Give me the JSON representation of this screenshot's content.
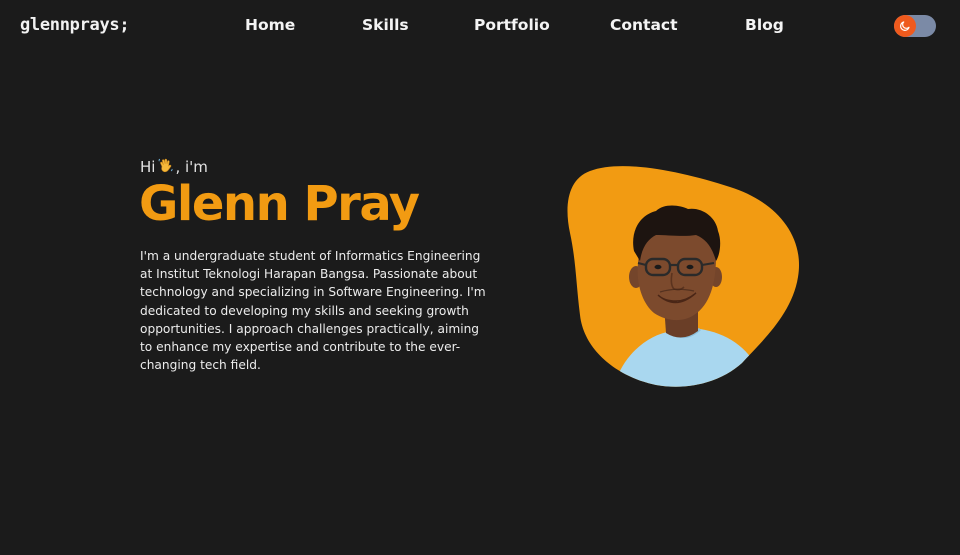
{
  "header": {
    "logo": "glennprays;",
    "nav": {
      "home": "Home",
      "skills": "Skills",
      "portfolio": "Portfolio",
      "contact": "Contact",
      "blog": "Blog"
    },
    "theme_toggle": {
      "icon": "moon-icon",
      "state": "dark"
    }
  },
  "hero": {
    "greeting_before": "Hi",
    "greeting_icon": "waving-hand-icon",
    "greeting_after": ", i'm",
    "name": "Glenn Pray",
    "bio": "I'm a undergraduate student of Informatics Engineering at Institut Teknologi Harapan Bangsa. Passionate about technology and specializing in Software Engineering. I'm dedicated to developing my skills and seeking growth opportunities. I approach challenges practically, aiming to enhance my expertise and contribute to the ever-changing tech field.",
    "photo": "profile-photo"
  },
  "colors": {
    "background": "#1b1b1b",
    "accent": "#f29b12",
    "toggle_knob": "#ef5a1d",
    "toggle_track": "#7b8aa6",
    "text": "#f4f4f4"
  }
}
